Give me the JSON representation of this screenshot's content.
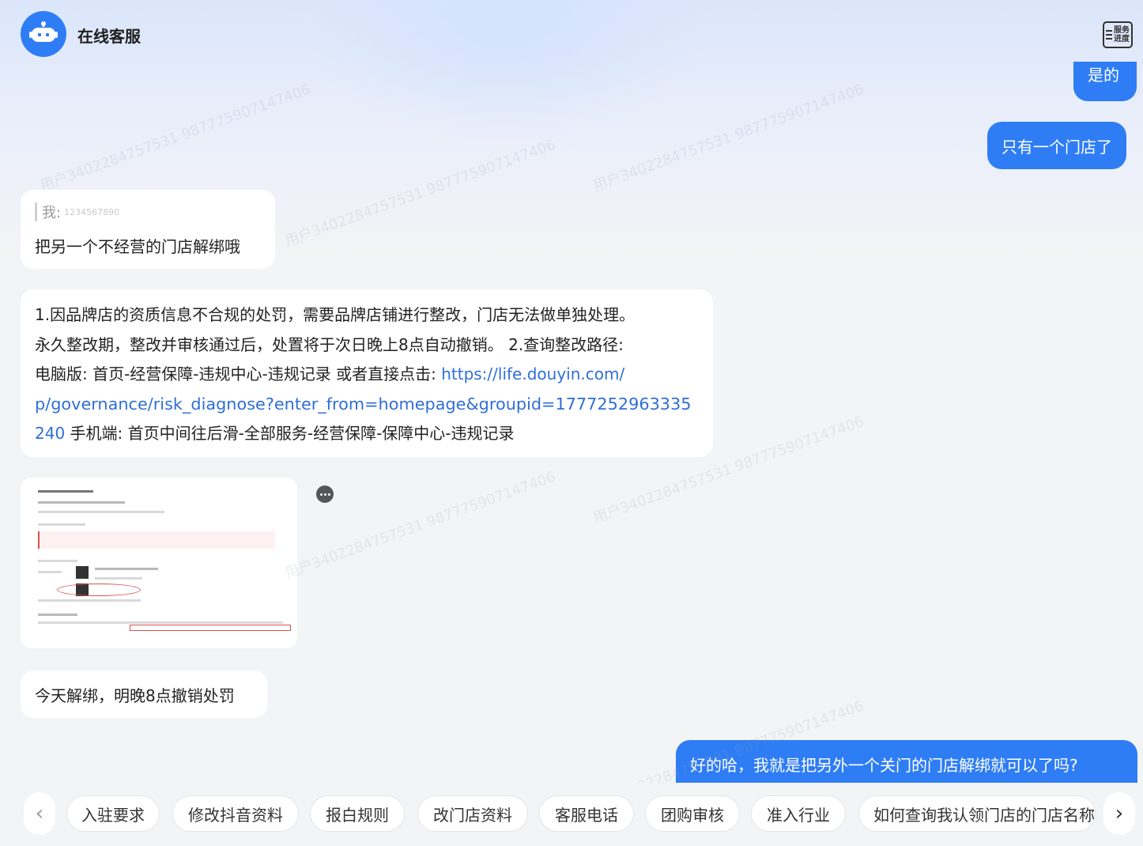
{
  "header": {
    "title": "在线客服",
    "progress_button": "服务进度",
    "progress_line1": "服务",
    "progress_line2": "进度"
  },
  "messages": {
    "user_1": "是的",
    "user_2": "只有一个门店了",
    "bot_quote_label": "我:",
    "bot_quote_name": "1234567890",
    "bot_quote_text": "把另一个不经营的门店解绑哦",
    "bot_answer_line1": "1.因品牌店的资质信息不合规的处罚，需要品牌店铺进行整改，门店无法做单独处理。",
    "bot_answer_line2": "永久整改期，整改并审核通过后，处置将于次日晚上8点自动撤销。 2.查询整改路径:",
    "bot_answer_line3_text": "电脑版: 首页-经营保障-违规中心-违规记录 或者直接点击: ",
    "bot_answer_line3_link": "https://life.douyin.com/",
    "bot_answer_line4_link": "p/governance/risk_diagnose?enter_from=homepage&groupid=1777252963335",
    "bot_answer_line5_link": "240",
    "bot_answer_line5_text": "  手机端: 首页中间往后滑-全部服务-经营保障-保障中心-违规记录",
    "bot_short": "今天解绑，明晚8点撤销处罚",
    "user_3": "好的哈，我就是把另外一个关门的门店解绑就可以了吗?"
  },
  "quick_replies": [
    "入驻要求",
    "修改抖音资料",
    "报白规则",
    "改门店资料",
    "客服电话",
    "团购审核",
    "准入行业",
    "如何查询我认领门店的门店名称"
  ],
  "colors": {
    "accent": "#2f7df5",
    "link": "#2f6fd6",
    "bubble_bot": "#ffffff",
    "background": "#f3f4f6"
  }
}
